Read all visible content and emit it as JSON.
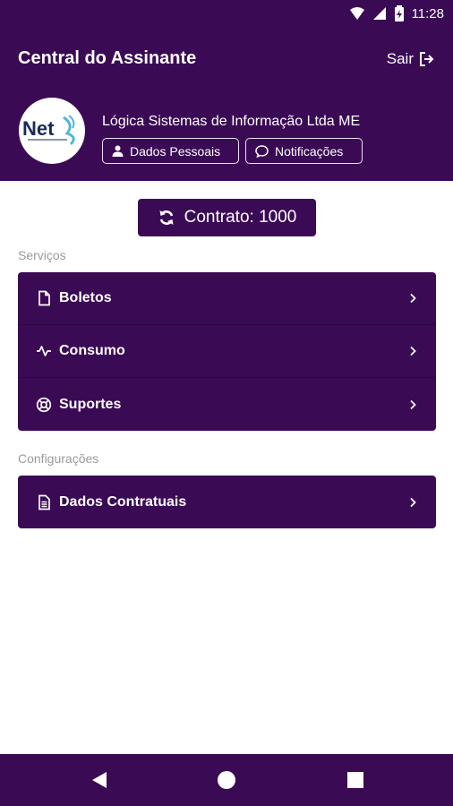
{
  "status": {
    "time": "11:28"
  },
  "header": {
    "title": "Central do Assinante",
    "logout_label": "Sair"
  },
  "profile": {
    "logo_text": "Net",
    "company_name": "Lógica Sistemas de Informação Ltda ME",
    "personal_data_label": "Dados Pessoais",
    "notifications_label": "Notificações"
  },
  "contract": {
    "label": "Contrato: 1000"
  },
  "services": {
    "section_label": "Serviços",
    "items": [
      {
        "label": "Boletos",
        "icon": "file-icon"
      },
      {
        "label": "Consumo",
        "icon": "activity-icon"
      },
      {
        "label": "Suportes",
        "icon": "lifebuoy-icon"
      }
    ]
  },
  "settings": {
    "section_label": "Configurações",
    "items": [
      {
        "label": "Dados Contratuais",
        "icon": "document-icon"
      }
    ]
  },
  "colors": {
    "primary": "#3b0a55",
    "background": "#ffffff",
    "muted_text": "#9a9a9a"
  }
}
